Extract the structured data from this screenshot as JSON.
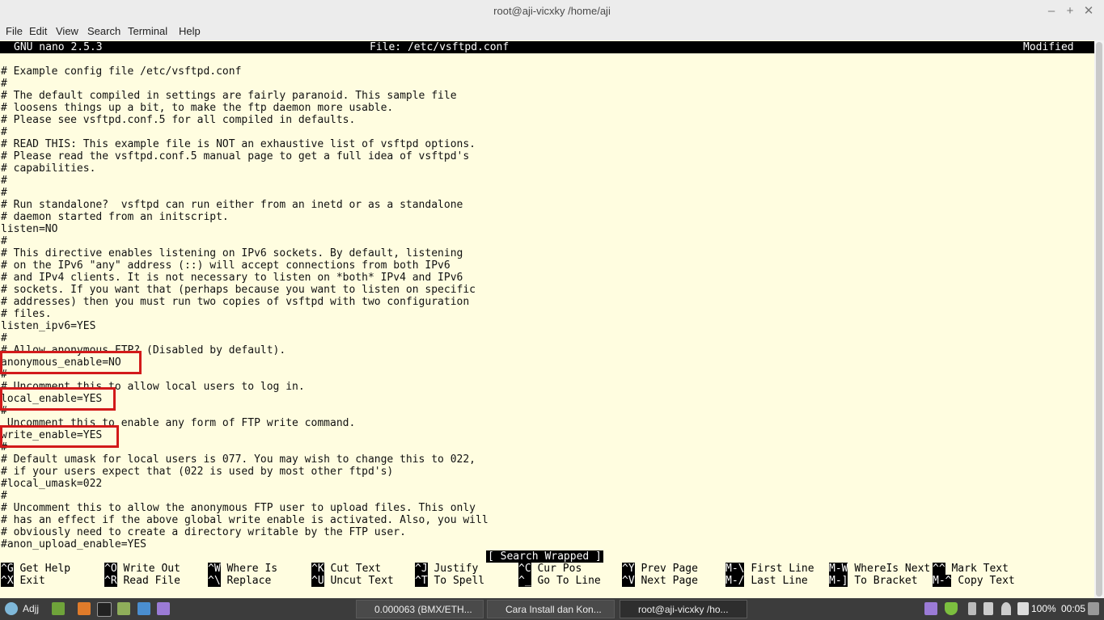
{
  "window": {
    "title": "root@aji-vicxky /home/aji"
  },
  "menu": [
    "File",
    "Edit",
    "View",
    "Search",
    "Terminal",
    "Help"
  ],
  "nano": {
    "version": "GNU nano 2.5.3",
    "file": "File: /etc/vsftpd.conf",
    "state": "Modified",
    "status_message": "[ Search Wrapped ]"
  },
  "lines": [
    "",
    "# Example config file /etc/vsftpd.conf",
    "#",
    "# The default compiled in settings are fairly paranoid. This sample file",
    "# loosens things up a bit, to make the ftp daemon more usable.",
    "# Please see vsftpd.conf.5 for all compiled in defaults.",
    "#",
    "# READ THIS: This example file is NOT an exhaustive list of vsftpd options.",
    "# Please read the vsftpd.conf.5 manual page to get a full idea of vsftpd's",
    "# capabilities.",
    "#",
    "#",
    "# Run standalone?  vsftpd can run either from an inetd or as a standalone",
    "# daemon started from an initscript.",
    "listen=NO",
    "#",
    "# This directive enables listening on IPv6 sockets. By default, listening",
    "# on the IPv6 \"any\" address (::) will accept connections from both IPv6",
    "# and IPv4 clients. It is not necessary to listen on *both* IPv4 and IPv6",
    "# sockets. If you want that (perhaps because you want to listen on specific",
    "# addresses) then you must run two copies of vsftpd with two configuration",
    "# files.",
    "listen_ipv6=YES",
    "#",
    "# Allow anonymous FTP? (Disabled by default).",
    "anonymous_enable=NO",
    "#",
    "# Uncomment this to allow local users to log in.",
    "local_enable=YES",
    "#",
    " Uncomment this to enable any form of FTP write command.",
    "write_enable=YES",
    "#",
    "# Default umask for local users is 077. You may wish to change this to 022,",
    "# if your users expect that (022 is used by most other ftpd's)",
    "#local_umask=022",
    "#",
    "# Uncomment this to allow the anonymous FTP user to upload files. This only",
    "# has an effect if the above global write enable is activated. Also, you will",
    "# obviously need to create a directory writable by the FTP user.",
    "#anon_upload_enable=YES"
  ],
  "shortcuts_row1": [
    {
      "key": "^G",
      "label": "Get Help"
    },
    {
      "key": "^O",
      "label": "Write Out"
    },
    {
      "key": "^W",
      "label": "Where Is"
    },
    {
      "key": "^K",
      "label": "Cut Text"
    },
    {
      "key": "^J",
      "label": "Justify"
    },
    {
      "key": "^C",
      "label": "Cur Pos"
    },
    {
      "key": "^Y",
      "label": "Prev Page"
    },
    {
      "key": "M-\\",
      "label": "First Line"
    },
    {
      "key": "M-W",
      "label": "WhereIs Next"
    },
    {
      "key": "^^",
      "label": "Mark Text"
    }
  ],
  "shortcuts_row2": [
    {
      "key": "^X",
      "label": "Exit"
    },
    {
      "key": "^R",
      "label": "Read File"
    },
    {
      "key": "^\\",
      "label": "Replace"
    },
    {
      "key": "^U",
      "label": "Uncut Text"
    },
    {
      "key": "^T",
      "label": "To Spell"
    },
    {
      "key": "^_",
      "label": "Go To Line"
    },
    {
      "key": "^V",
      "label": "Next Page"
    },
    {
      "key": "M-/",
      "label": "Last Line"
    },
    {
      "key": "M-]",
      "label": "To Bracket"
    },
    {
      "key": "M-^",
      "label": "Copy Text"
    }
  ],
  "taskbar": {
    "user": "Adjj",
    "tasks": [
      {
        "label": "0.000063 (BMX/ETH...",
        "active": false
      },
      {
        "label": "Cara Install dan Kon...",
        "active": false
      },
      {
        "label": "root@aji-vicxky /ho...",
        "active": true
      }
    ],
    "battery": "100%",
    "clock": "00:05"
  },
  "colors": {
    "terminal_bg": "#fffde0",
    "highlight": "#d21a1a"
  }
}
